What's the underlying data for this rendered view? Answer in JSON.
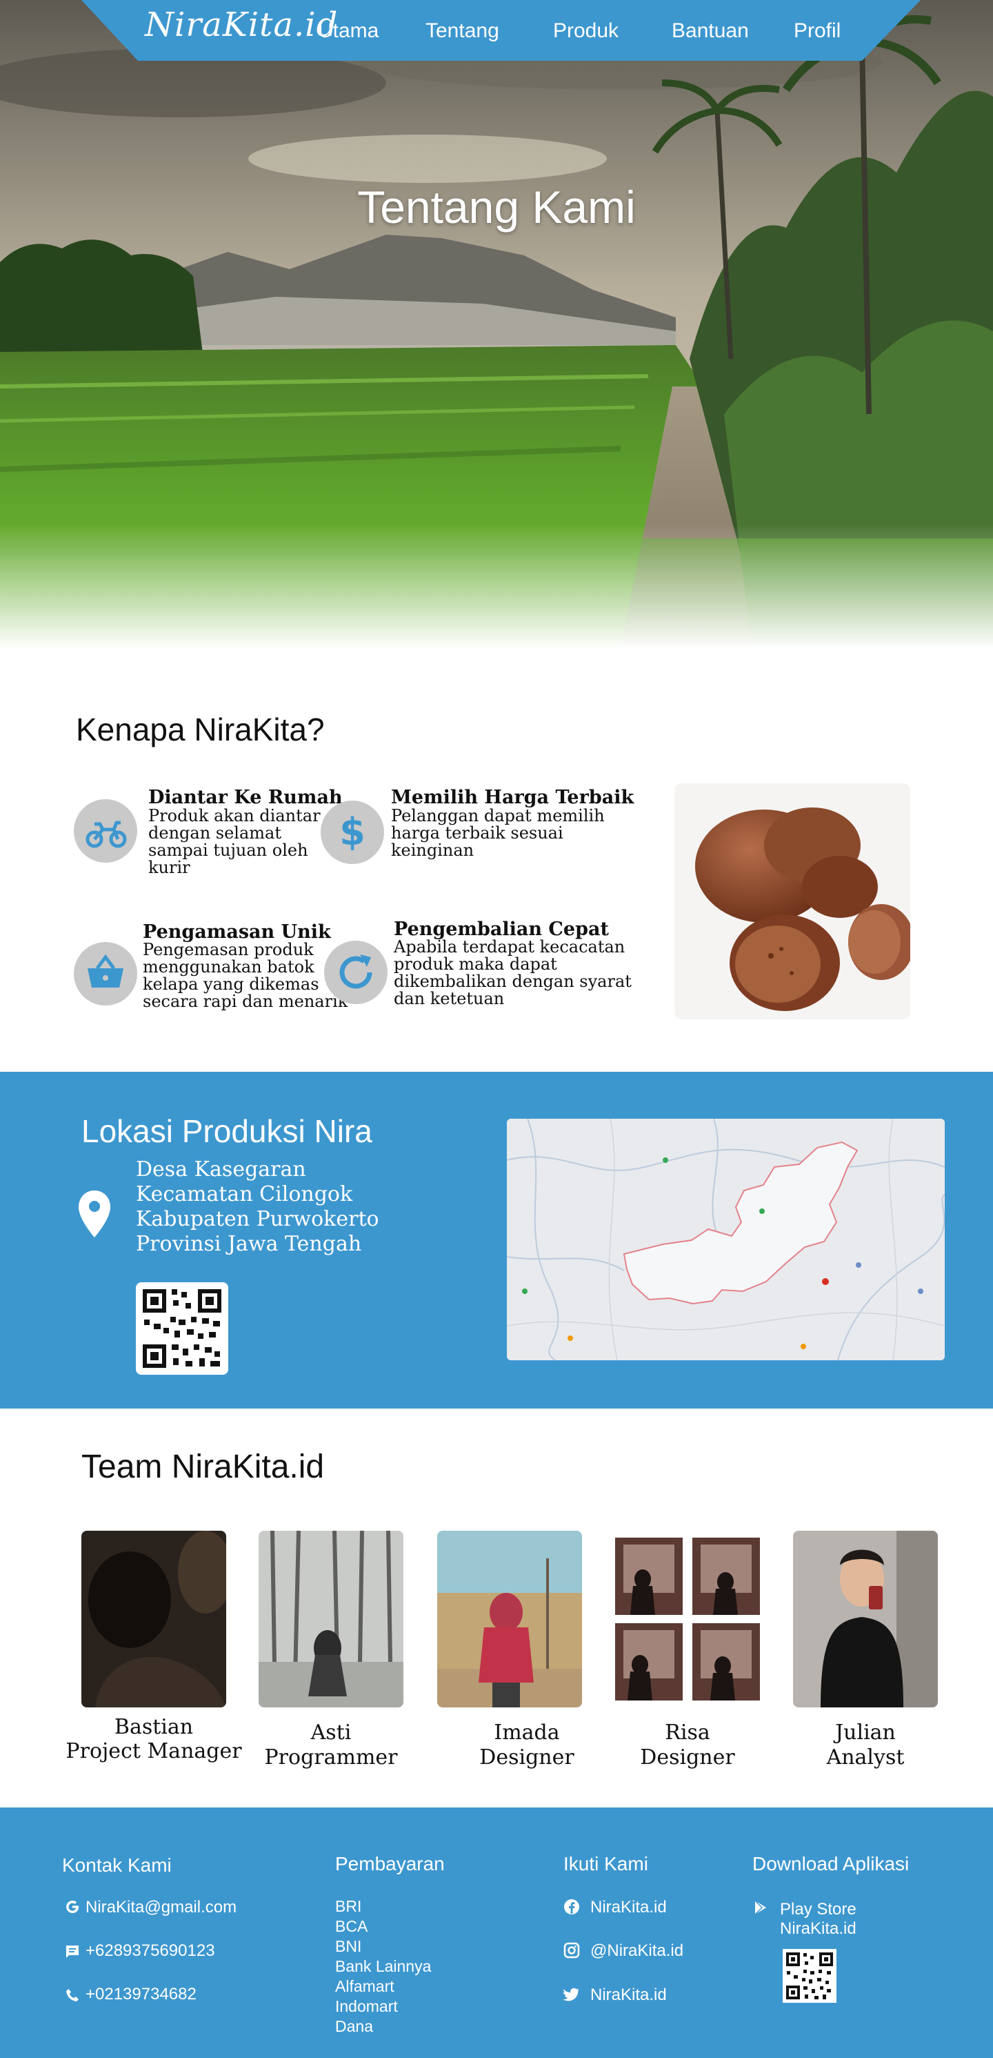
{
  "nav": {
    "logo": "NiraKita.id",
    "items": [
      "Utama",
      "Tentang",
      "Produk",
      "Bantuan",
      "Profil"
    ]
  },
  "hero": {
    "title": "Tentang Kami"
  },
  "why": {
    "title": "Kenapa NiraKita?",
    "features": [
      {
        "icon": "motorcycle-icon",
        "title": "Diantar Ke Rumah",
        "desc": [
          "Produk akan diantar",
          "dengan selamat",
          "sampai tujuan oleh",
          "kurir"
        ]
      },
      {
        "icon": "dollar-icon",
        "title": "Memilih Harga Terbaik",
        "desc": [
          "Pelanggan dapat memilih",
          "harga terbaik sesuai",
          "keinginan"
        ]
      },
      {
        "icon": "basket-icon",
        "title": "Pengamasan Unik",
        "desc": [
          "Pengemasan produk",
          "menggunakan batok",
          "kelapa yang dikemas",
          "secara rapi dan menarik"
        ]
      },
      {
        "icon": "refresh-icon",
        "title": "Pengembalian Cepat",
        "desc": [
          "Apabila terdapat kecacatan",
          "produk maka dapat",
          "dikembalikan dengan syarat",
          "dan ketetuan"
        ]
      }
    ]
  },
  "location": {
    "title": "Lokasi Produksi Nira",
    "address": [
      "Desa Kasegaran",
      "Kecamatan Cilongok",
      "Kabupaten Purwokerto",
      "Provinsi Jawa Tengah"
    ]
  },
  "team": {
    "title": "Team NiraKita.id",
    "members": [
      {
        "name": "Bastian",
        "role": "Project Manager"
      },
      {
        "name": "Asti",
        "role": "Programmer"
      },
      {
        "name": "Imada",
        "role": "Designer"
      },
      {
        "name": "Risa",
        "role": "Designer"
      },
      {
        "name": "Julian",
        "role": "Analyst"
      }
    ]
  },
  "footer": {
    "contact": {
      "heading": "Kontak Kami",
      "email": "NiraKita@gmail.com",
      "phone": "+6289375690123",
      "tel": "+02139734682"
    },
    "payment": {
      "heading": "Pembayaran",
      "items": [
        "BRI",
        "BCA",
        "BNI",
        "Bank Lainnya",
        "Alfamart",
        "Indomart",
        "Dana"
      ]
    },
    "follow": {
      "heading": "Ikuti Kami",
      "facebook": "NiraKita.id",
      "instagram": "@NiraKita.id",
      "twitter": "NiraKita.id"
    },
    "download": {
      "heading": "Download Aplikasi",
      "store": "Play Store",
      "app": "NiraKita.id"
    }
  },
  "colors": {
    "brand": "#3d97cf",
    "icon_bg": "#c9c9c9",
    "white": "#ffffff"
  }
}
